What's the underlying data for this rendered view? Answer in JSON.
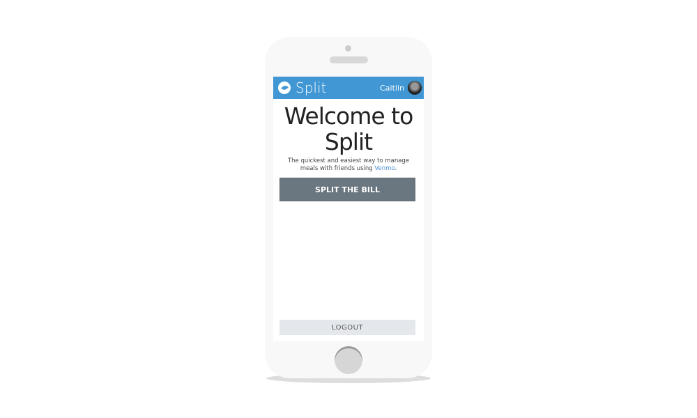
{
  "header": {
    "brand": "Split",
    "user": "Caitlin"
  },
  "main": {
    "title": "Welcome to Split",
    "tagline": "The quickest and easiest way to manage meals with friends using ",
    "tagline_link": "Venmo",
    "tagline_end": ".",
    "cta": "SPLIT THE BILL",
    "logout": "LOGOUT"
  },
  "colors": {
    "header": "#4097d3",
    "cta": "#6b7780"
  }
}
